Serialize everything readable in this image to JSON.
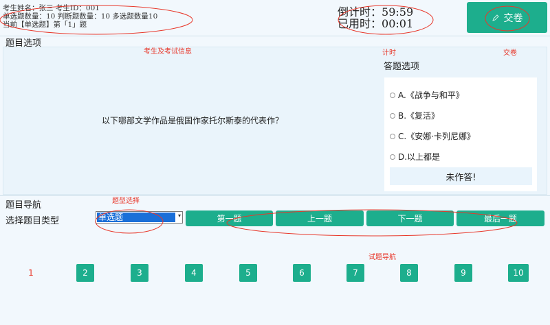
{
  "header": {
    "info_lines": [
      "考生姓名：张三  考生ID：001",
      "单选题数量：10  判断题数量：10  多选题数量10",
      "当前【单选题】第「1」题"
    ],
    "countdown_label": "倒计时：",
    "countdown_value": "59:59",
    "elapsed_label": "已用时：",
    "elapsed_value": "00:01",
    "submit_label": "交卷",
    "submit_icon": "pen-icon"
  },
  "question_panel": {
    "title": "题目选项",
    "answer_title": "答题选项",
    "question": "以下哪部文学作品是俄国作家托尔斯泰的代表作？",
    "options": [
      "A.《战争与和平》",
      "B.《复活》",
      "C.《安娜·卡列尼娜》",
      "D.以上都是"
    ],
    "answer_status": "未作答!"
  },
  "navigation": {
    "title": "题目导航",
    "type_label": "选择题目类型",
    "type_selected": "单选题",
    "buttons": [
      "第一题",
      "上一题",
      "下一题",
      "最后一题"
    ],
    "question_numbers": [
      "1",
      "2",
      "3",
      "4",
      "5",
      "6",
      "7",
      "8",
      "9",
      "10"
    ],
    "current_question": "1"
  },
  "annotations": {
    "info": "考生及考试信息",
    "timer": "计时",
    "submit": "交卷",
    "type_select": "题型选择",
    "question_nav": "试题导航"
  },
  "colors": {
    "accent": "#1dae8d",
    "annotation": "#e8372a",
    "panel_bg": "#eaf4fb",
    "selection": "#1a6fd8"
  }
}
